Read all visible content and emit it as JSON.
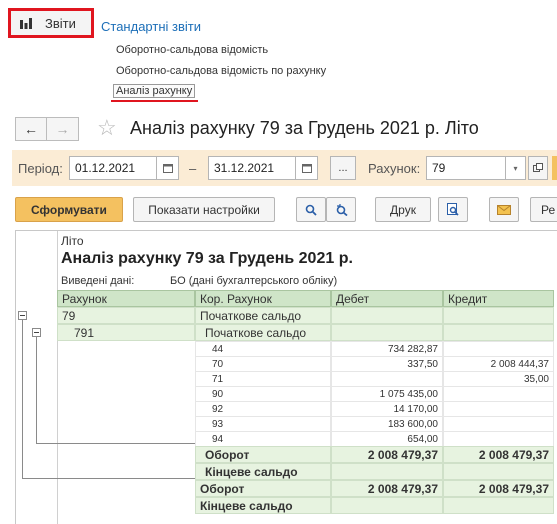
{
  "nav": {
    "reports_button_label": "Звіти",
    "standard_reports_link": "Стандартні звіти",
    "menu": [
      "Оборотно-сальдова відомість",
      "Оборотно-сальдова відомість по рахунку",
      "Аналіз рахунку"
    ]
  },
  "title_bar": {
    "back": "←",
    "forward": "→",
    "star": "☆",
    "title": "Аналіз рахунку 79 за Грудень 2021 р. Літо"
  },
  "params": {
    "period_label": "Період:",
    "date_from": "01.12.2021",
    "dash": "–",
    "date_to": "31.12.2021",
    "ellipsis": "...",
    "account_label": "Рахунок:",
    "account_value": "79"
  },
  "toolbar": {
    "generate": "Сформувати",
    "show_settings": "Показати настройки",
    "print": "Друк",
    "cut_label": "Ре"
  },
  "report": {
    "org": "Літо",
    "heading": "Аналіз рахунку 79 за Грудень 2021 р.",
    "meta_label": "Виведені дані:",
    "meta_value": "БО (дані бухгалтерського обліку)",
    "columns": [
      "Рахунок",
      "Кор. Рахунок",
      "Дебет",
      "Кредит"
    ],
    "group_account": "79",
    "group_opening": "Початкове сальдо",
    "sub_account": "791",
    "sub_opening": "Початкове сальдо",
    "details": [
      {
        "acc": "44",
        "debit": "734 282,87",
        "credit": ""
      },
      {
        "acc": "70",
        "debit": "337,50",
        "credit": "2 008 444,37"
      },
      {
        "acc": "71",
        "debit": "",
        "credit": "35,00"
      },
      {
        "acc": "90",
        "debit": "1 075 435,00",
        "credit": ""
      },
      {
        "acc": "92",
        "debit": "14 170,00",
        "credit": ""
      },
      {
        "acc": "93",
        "debit": "183 600,00",
        "credit": ""
      },
      {
        "acc": "94",
        "debit": "654,00",
        "credit": ""
      }
    ],
    "sub_turnover": {
      "label": "Оборот",
      "debit": "2 008 479,37",
      "credit": "2 008 479,37"
    },
    "sub_closing": "Кінцеве сальдо",
    "turnover": {
      "label": "Оборот",
      "debit": "2 008 479,37",
      "credit": "2 008 479,37"
    },
    "closing": "Кінцеве сальдо"
  },
  "colors": {
    "highlight_red": "#e0151f",
    "param_bar": "#fbecd5",
    "primary_button": "#f4c160",
    "header_green": "#cfe5c8",
    "group_green": "#e7f3e0",
    "link_blue": "#1d6fb8"
  }
}
